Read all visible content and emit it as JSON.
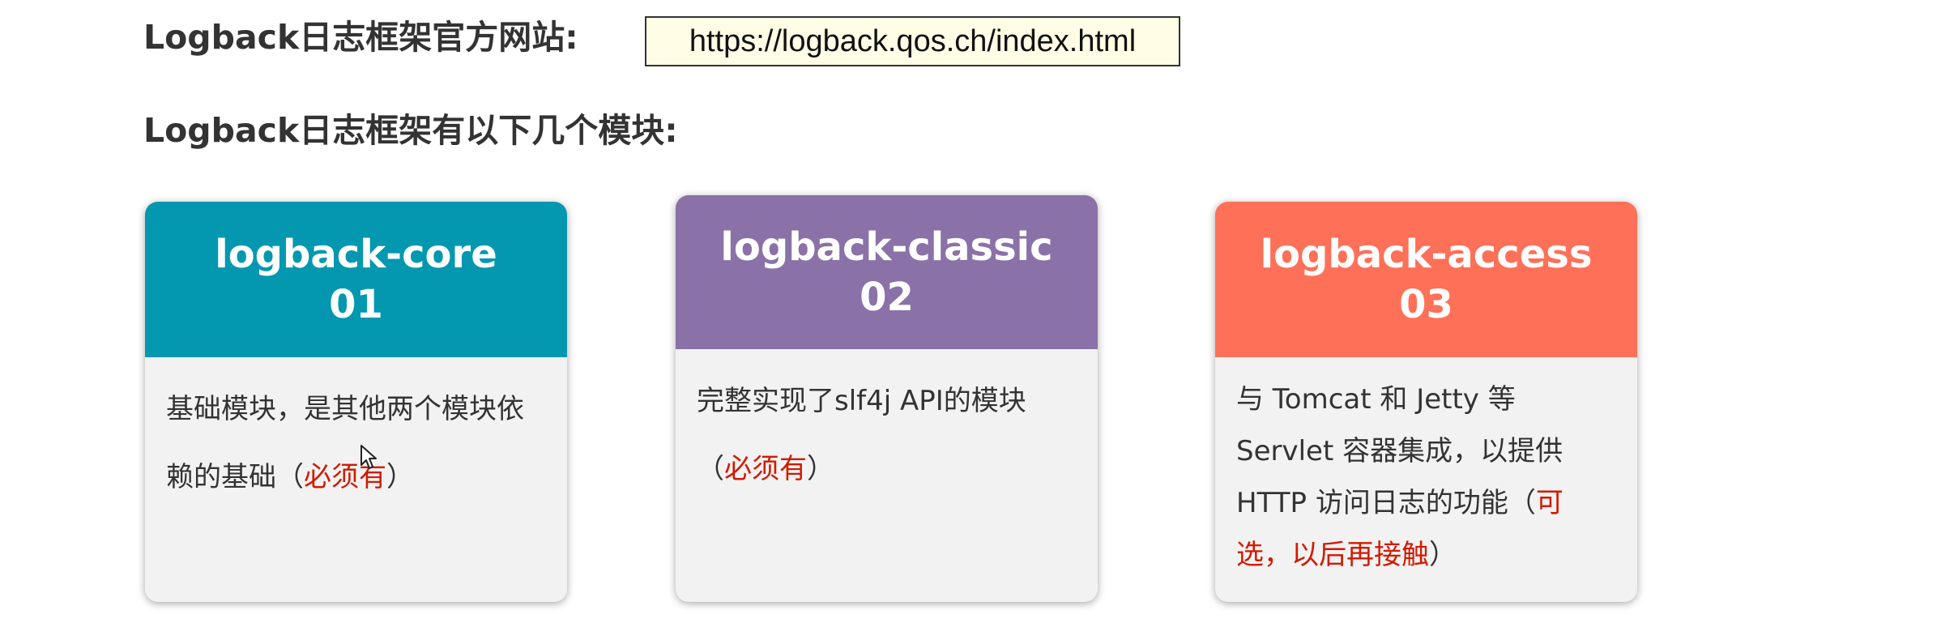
{
  "headings": {
    "site_label": "Logback日志框架官方网站:",
    "modules_label": "Logback日志框架有以下几个模块:"
  },
  "url": "https://logback.qos.ch/index.html",
  "cards": [
    {
      "title": "logback-core",
      "number": "01",
      "text": "基础模块，是其他两个模块依赖的基础（",
      "highlight": "必须有",
      "text_end": "）",
      "color": "#0398b0"
    },
    {
      "title": "logback-classic",
      "number": "02",
      "text": "完整实现了slf4j API的模块（",
      "highlight": "必须有",
      "text_end": "）",
      "color": "#8a72a8"
    },
    {
      "title": "logback-access",
      "number": "03",
      "text": "与 Tomcat 和 Jetty 等 Servlet 容器集成，以提供 HTTP 访问日志的功能（",
      "highlight": "可选，以后再接触",
      "text_end": "）",
      "color": "#ff7058"
    }
  ],
  "colors": {
    "highlight_red": "#d11a00",
    "card_body_bg": "#f2f2f2",
    "url_box_bg": "#fffde6"
  }
}
